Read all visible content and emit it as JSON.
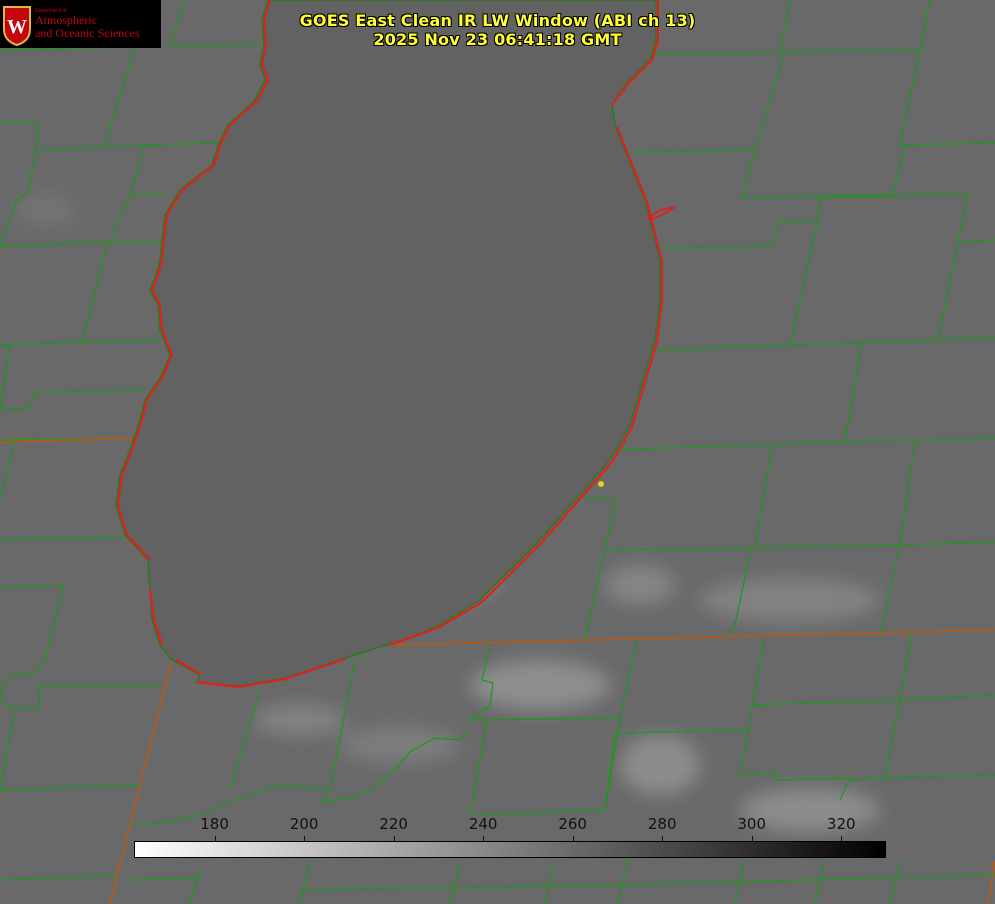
{
  "title_line1": "GOES East Clean IR LW Window (ABI ch 13)",
  "title_line2": "2025 Nov 23 06:41:18 GMT",
  "logo": {
    "department": "Department of",
    "line1": "Atmospheric",
    "line2": "and Oceanic Sciences",
    "crest_letter": "W"
  },
  "colorbar": {
    "ticks": [
      "180",
      "200",
      "220",
      "240",
      "260",
      "280",
      "300",
      "320"
    ],
    "min": 162,
    "max": 330,
    "color_min": "#ffffff",
    "color_max": "#000000"
  },
  "colors": {
    "county_lines": "#1a9a1a",
    "state_lines": "#b35a1a",
    "coastline": "#e02020",
    "site_marker": "#e8d020",
    "title": "#ffff33"
  }
}
